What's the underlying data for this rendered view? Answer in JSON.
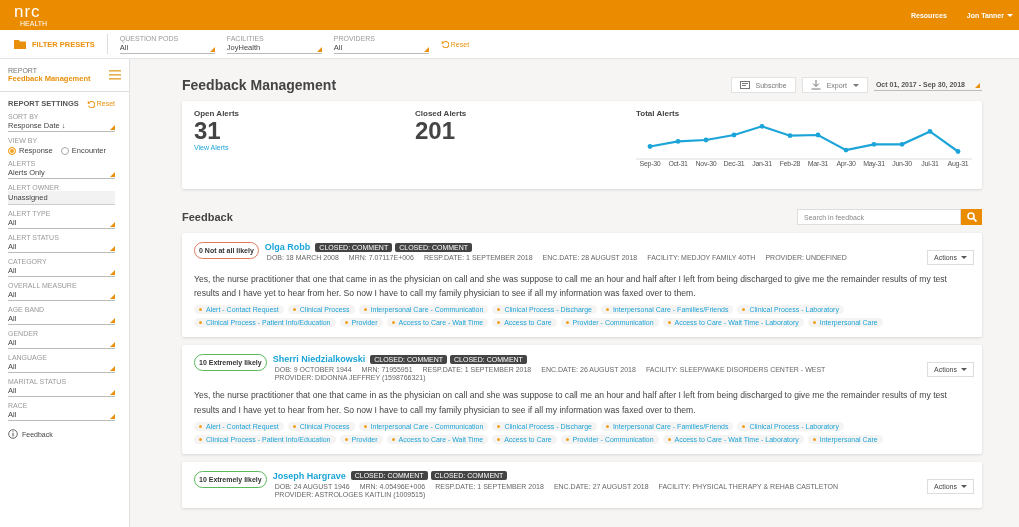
{
  "header": {
    "logo": "nrc",
    "logo_sub": "HEALTH",
    "links": [
      "Resources",
      "Jon Tanner"
    ]
  },
  "filter_bar": {
    "presets_label": "FILTER PRESETS",
    "filters": [
      {
        "label": "QUESTION PODS",
        "value": "All"
      },
      {
        "label": "FACILITIES",
        "value": "JoyHealth"
      },
      {
        "label": "PROVIDERS",
        "value": "All"
      }
    ],
    "reset": "Reset"
  },
  "sidebar": {
    "report_label": "REPORT",
    "report_name": "Feedback Management",
    "settings_title": "REPORT SETTINGS",
    "reset": "Reset",
    "fields": [
      {
        "kind": "select",
        "label": "SORT BY",
        "value": "Response Date ↓"
      },
      {
        "kind": "radio",
        "label": "VIEW BY",
        "options": [
          {
            "label": "Response",
            "selected": true
          },
          {
            "label": "Encounter",
            "selected": false
          }
        ]
      },
      {
        "kind": "select",
        "label": "ALERTS",
        "value": "Alerts Only"
      },
      {
        "kind": "text",
        "label": "ALERT OWNER",
        "value": "Unassigned"
      },
      {
        "kind": "select",
        "label": "ALERT TYPE",
        "value": "All"
      },
      {
        "kind": "select",
        "label": "ALERT STATUS",
        "value": "All"
      },
      {
        "kind": "select",
        "label": "CATEGORY",
        "value": "All"
      },
      {
        "kind": "select",
        "label": "OVERALL MEASURE",
        "value": "All"
      },
      {
        "kind": "select",
        "label": "AGE BAND",
        "value": "All"
      },
      {
        "kind": "select",
        "label": "GENDER",
        "value": "All"
      },
      {
        "kind": "select",
        "label": "LANGUAGE",
        "value": "All"
      },
      {
        "kind": "select",
        "label": "MARITAL STATUS",
        "value": "All"
      },
      {
        "kind": "select",
        "label": "RACE",
        "value": "All"
      }
    ],
    "feedback_link": "Feedback"
  },
  "page": {
    "title": "Feedback Management",
    "subscribe": "Subscribe",
    "export": "Export",
    "date_range": "Oct 01, 2017 - Sep 30, 2018"
  },
  "summary": {
    "open_label": "Open Alerts",
    "open_value": "31",
    "view_link": "View Alerts",
    "closed_label": "Closed Alerts",
    "closed_value": "201",
    "chart_title": "Total Alerts",
    "chart_labels": [
      "Sep-30",
      "Oct-31",
      "Nov-30",
      "Dec-31",
      "Jan-31",
      "Feb-28",
      "Mar-31",
      "Apr-30",
      "May-31",
      "Jun-30",
      "Jul-31",
      "Aug-31"
    ]
  },
  "feedback": {
    "title": "Feedback",
    "search_placeholder": "Search in feedback",
    "items": [
      {
        "score": "0 Not at all likely",
        "color": "#e07a5f",
        "name": "Olga Robb",
        "badges": [
          "CLOSED: COMMENT",
          "CLOSED: COMMENT"
        ],
        "meta": [
          "DOB: 18 MARCH 2008",
          "MRN: 7.07117E+006",
          "RESP.DATE: 1 SEPTEMBER 2018",
          "ENC.DATE: 28 AUGUST 2018",
          "FACILITY: MEDJOY FAMILY 40TH",
          "PROVIDER: UNDEFINED"
        ],
        "actions": "Actions",
        "comment": "Yes, the nurse practitioner that one that came in as the physician on call and she was suppose to call me an hour and half after I left from being discharged to give me the remainder results of my test results and I have yet to hear from her. So now I have to call my family physician to see if all my information was faxed over to them.",
        "tags": [
          "Alert - Contact Request",
          "Clinical Process",
          "Interpersonal Care - Communication",
          "Clinical Process - Discharge",
          "Interpersonal Care - Families/Friends",
          "Clinical Process - Laboratory",
          "Clinical Process - Patient Info/Education",
          "Provider",
          "Access to Care - Wait Time",
          "Access to Care",
          "Provider - Communication",
          "Access to Care - Wait Time - Laboratory",
          "Interpersonal Care"
        ]
      },
      {
        "score": "10 Extremely likely",
        "color": "#5cb85c",
        "name": "Sherri Niedzialkowski",
        "badges": [
          "CLOSED: COMMENT",
          "CLOSED: COMMENT"
        ],
        "meta": [
          "DOB: 9 OCTOBER 1944",
          "MRN: 71955951",
          "RESP.DATE: 1 SEPTEMBER 2018",
          "ENC.DATE: 26 AUGUST 2018",
          "FACILITY: SLEEP/WAKE DISORDERS CENTER - WEST",
          "PROVIDER: DIDONNA JEFFREY (1598766321)"
        ],
        "actions": "Actions",
        "comment": "Yes, the nurse practitioner that one that came in as the physician on call and she was suppose to call me an hour and half after I left from being discharged to give me the remainder results of my test results and I have yet to hear from her. So now I have to call my family physician to see if all my information was faxed over to them.",
        "tags": [
          "Alert - Contact Request",
          "Clinical Process",
          "Interpersonal Care - Communication",
          "Clinical Process - Discharge",
          "Interpersonal Care - Families/Friends",
          "Clinical Process - Laboratory",
          "Clinical Process - Patient Info/Education",
          "Provider",
          "Access to Care - Wait Time",
          "Access to Care",
          "Provider - Communication",
          "Access to Care - Wait Time - Laboratory",
          "Interpersonal Care"
        ]
      },
      {
        "score": "10 Extremely likely",
        "color": "#5cb85c",
        "name": "Joseph Hargrave",
        "badges": [
          "CLOSED: COMMENT",
          "CLOSED: COMMENT"
        ],
        "meta": [
          "DOB: 24 AUGUST 1946",
          "MRN: 4.05496E+006",
          "RESP.DATE: 1 SEPTEMBER 2018",
          "ENC.DATE: 27 AUGUST 2018",
          "FACILITY: PHYSICAL THERAPY & REHAB CASTLETON",
          "PROVIDER: ASTROLOGES KAITLIN (1009515)"
        ],
        "actions": "Actions"
      }
    ]
  }
}
